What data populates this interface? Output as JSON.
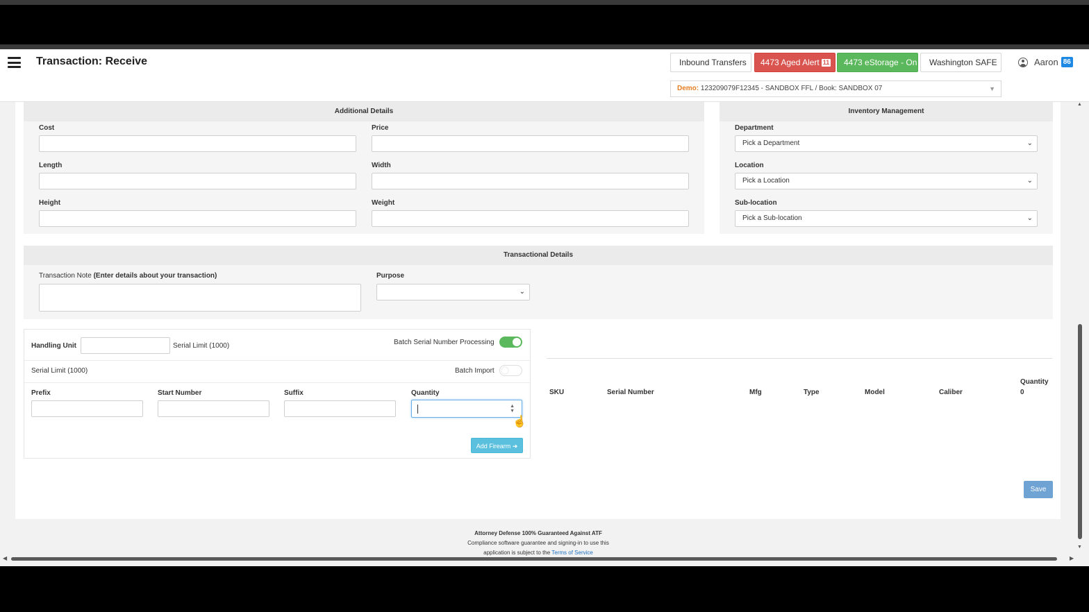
{
  "header": {
    "title": "Transaction: Receive",
    "buttons": {
      "inbound": "Inbound Transfers",
      "aged_alert": "4473 Aged Alert",
      "aged_badge": "11",
      "estorage": "4473 eStorage - On",
      "safe": "Washington SAFE"
    },
    "user": {
      "name": "Aaron",
      "badge": "86"
    },
    "demo_select": {
      "label": "Demo:",
      "value": "123209079F12345 - SANDBOX FFL / Book: SANDBOX 07"
    }
  },
  "additional_details": {
    "heading": "Additional Details",
    "fields": {
      "cost": "Cost",
      "price": "Price",
      "length": "Length",
      "width": "Width",
      "height": "Height",
      "weight": "Weight"
    }
  },
  "inventory_management": {
    "heading": "Inventory Management",
    "department": {
      "label": "Department",
      "value": "Pick a Department"
    },
    "location": {
      "label": "Location",
      "value": "Pick a Location"
    },
    "sublocation": {
      "label": "Sub-location",
      "value": "Pick a Sub-location"
    }
  },
  "transactional_details": {
    "heading": "Transactional Details",
    "note_label": "Transaction Note",
    "note_hint": "(Enter details about your transaction)",
    "purpose_label": "Purpose",
    "purpose_value": ""
  },
  "batch": {
    "handling_unit_label": "Handling Unit",
    "serial_limit": "Serial Limit (1000)",
    "batch_serial_label": "Batch Serial Number Processing",
    "batch_serial_on": true,
    "serial_limit_2": "Serial Limit (1000)",
    "batch_import_label": "Batch Import",
    "batch_import_on": false,
    "prefix_label": "Prefix",
    "start_number_label": "Start Number",
    "suffix_label": "Suffix",
    "quantity_label": "Quantity",
    "add_button": "Add Firearm"
  },
  "table": {
    "columns": [
      "SKU",
      "Serial Number",
      "Mfg",
      "Type",
      "Model",
      "Caliber",
      "Quantity"
    ],
    "quantity_total": "0"
  },
  "save_button": "Save",
  "footer": {
    "line1": "Attorney Defense 100% Guaranteed Against ATF",
    "line2": "Compliance software guarantee and signing-in to use this",
    "line3_prefix": "application is subject to the",
    "line3_link": "Terms of Service"
  },
  "colors": {
    "danger": "#d9534f",
    "success": "#5cb85c",
    "info": "#5bc0de",
    "primary": "#6fa3d4"
  }
}
